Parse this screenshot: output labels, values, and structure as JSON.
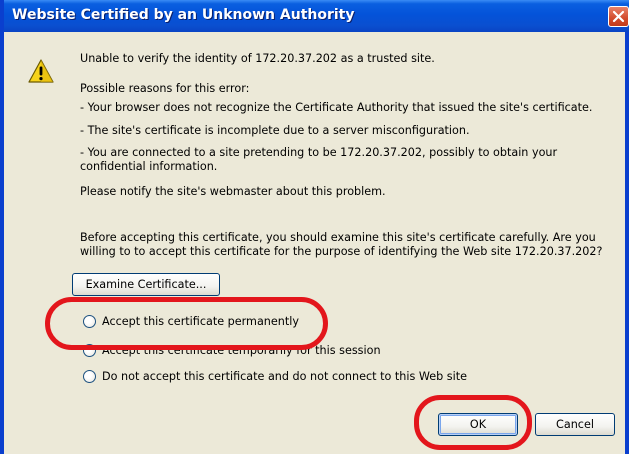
{
  "dialog": {
    "title": "Website Certified by an Unknown Authority",
    "title_bar_color": "#0a4fd0",
    "icon": "warning-triangle-icon",
    "close_icon": "close-icon"
  },
  "messages": {
    "intro": "Unable to verify the identity of 172.20.37.202 as a trusted site.",
    "reasons_heading": "Possible reasons for this error:",
    "reason_1": "- Your browser does not recognize the Certificate Authority that issued the site's certificate.",
    "reason_2": "- The site's certificate is incomplete due to a server misconfiguration.",
    "reason_3_line1": "- You are connected to a site pretending to be 172.20.37.202, possibly to obtain your",
    "reason_3_line2": "confidential information.",
    "notify": "Please notify the site's webmaster about this problem.",
    "question_line1": "Before accepting this certificate, you should examine this site's certificate carefully. Are you",
    "question_line2": "willing to to accept this certificate for the purpose of identifying the Web site 172.20.37.202?"
  },
  "buttons": {
    "examine": "Examine Certificate...",
    "ok": "OK",
    "cancel": "Cancel"
  },
  "options": [
    {
      "label": "Accept this certificate permanently",
      "selected": false
    },
    {
      "label": "Accept this certificate temporarily for this session",
      "selected": false
    },
    {
      "label": "Do not accept this certificate and do not connect to this Web site",
      "selected": false
    }
  ],
  "annotation_color": "#e3161c"
}
